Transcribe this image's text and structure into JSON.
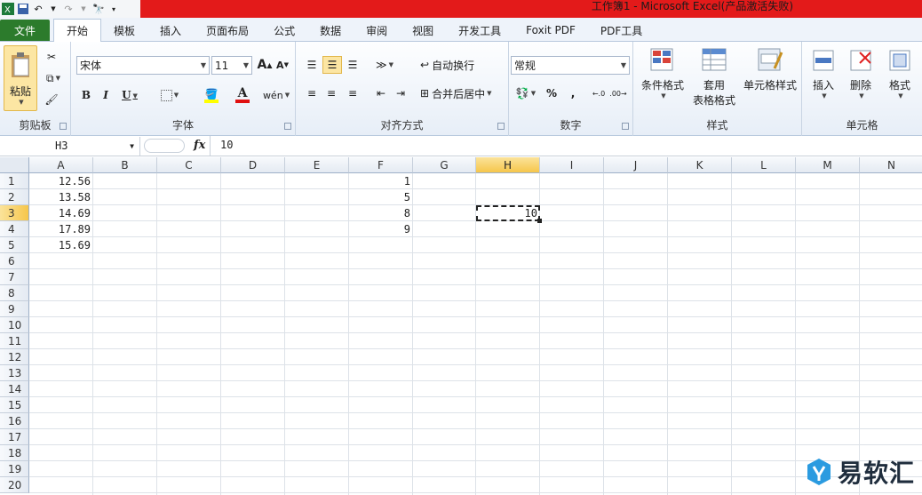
{
  "window": {
    "title": "工作簿1 - Microsoft Excel(产品激活失败)"
  },
  "tabs": [
    "文件",
    "开始",
    "模板",
    "插入",
    "页面布局",
    "公式",
    "数据",
    "审阅",
    "视图",
    "开发工具",
    "Foxit PDF",
    "PDF工具"
  ],
  "active_tab": "开始",
  "ribbon": {
    "clipboard": {
      "label": "剪贴板",
      "paste": "粘贴"
    },
    "font": {
      "label": "字体",
      "name": "宋体",
      "size": "11"
    },
    "alignment": {
      "label": "对齐方式",
      "wrap": "自动换行",
      "merge": "合并后居中"
    },
    "number": {
      "label": "数字",
      "format": "常规"
    },
    "styles": {
      "label": "样式",
      "cond": "条件格式",
      "table1": "套用",
      "table2": "表格格式",
      "cellstyle": "单元格样式"
    },
    "cells": {
      "label": "单元格",
      "insert": "插入",
      "delete": "删除",
      "format": "格式"
    }
  },
  "formula_bar": {
    "name_box": "H3",
    "fx": "fx",
    "value": "10"
  },
  "columns": [
    "A",
    "B",
    "C",
    "D",
    "E",
    "F",
    "G",
    "H",
    "I",
    "J",
    "K",
    "L",
    "M",
    "N"
  ],
  "rows": [
    "1",
    "2",
    "3",
    "4",
    "5",
    "6",
    "7",
    "8",
    "9",
    "10",
    "11",
    "12",
    "13",
    "14",
    "15",
    "16",
    "17",
    "18",
    "19",
    "20"
  ],
  "cells": {
    "A": [
      "12.56",
      "13.58",
      "14.69",
      "17.89",
      "15.69"
    ],
    "F": [
      "1",
      "5",
      "8",
      "9"
    ],
    "H3": "10"
  },
  "selected": {
    "column": "H",
    "row": "3"
  },
  "watermark": {
    "text": "易软汇"
  },
  "colors": {
    "title_red": "#e31a1a",
    "file_green": "#2c7b2c",
    "selection": "#f6c64b"
  }
}
